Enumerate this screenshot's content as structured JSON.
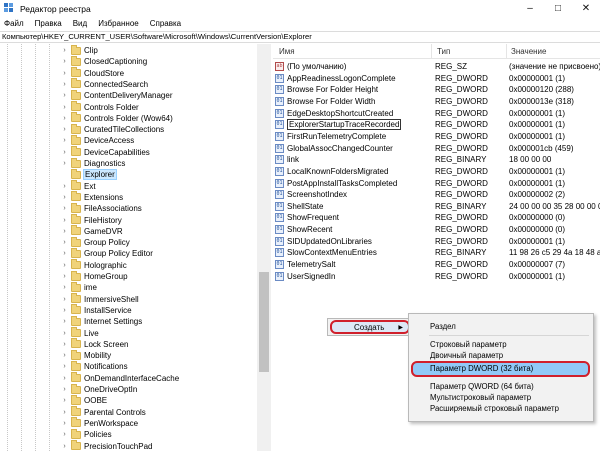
{
  "window": {
    "title": "Редактор реестра"
  },
  "menu": [
    "Файл",
    "Правка",
    "Вид",
    "Избранное",
    "Справка"
  ],
  "address": "Компьютер\\HKEY_CURRENT_USER\\Software\\Microsoft\\Windows\\CurrentVersion\\Explorer",
  "tree": {
    "items": [
      "Clip",
      "ClosedCaptioning",
      "CloudStore",
      "ConnectedSearch",
      "ContentDeliveryManager",
      "Controls Folder",
      "Controls Folder (Wow64)",
      "CuratedTileCollections",
      "DeviceAccess",
      "DeviceCapabilities",
      "Diagnostics",
      "Explorer",
      "Ext",
      "Extensions",
      "FileAssociations",
      "FileHistory",
      "GameDVR",
      "Group Policy",
      "Group Policy Editor",
      "Holographic",
      "HomeGroup",
      "ime",
      "ImmersiveShell",
      "InstallService",
      "Internet Settings",
      "Live",
      "Lock Screen",
      "Mobility",
      "Notifications",
      "OnDemandInterfaceCache",
      "OneDriveOptIn",
      "OOBE",
      "Parental Controls",
      "PenWorkspace",
      "Policies",
      "PrecisionTouchPad"
    ],
    "expandable": [
      true,
      true,
      true,
      true,
      true,
      true,
      true,
      true,
      true,
      true,
      true,
      false,
      true,
      true,
      true,
      true,
      true,
      true,
      true,
      true,
      true,
      true,
      true,
      true,
      true,
      true,
      true,
      true,
      true,
      true,
      true,
      true,
      true,
      true,
      true,
      true
    ],
    "selected_index": 11
  },
  "list": {
    "headers": {
      "name": "Имя",
      "type": "Тип",
      "value": "Значение"
    },
    "rows": [
      {
        "icon": "sz",
        "name": "(По умолчанию)",
        "type": "REG_SZ",
        "value": "(значение не присвоено)"
      },
      {
        "icon": "bin",
        "name": "AppReadinessLogonComplete",
        "type": "REG_DWORD",
        "value": "0x00000001 (1)"
      },
      {
        "icon": "bin",
        "name": "Browse For Folder Height",
        "type": "REG_DWORD",
        "value": "0x00000120 (288)"
      },
      {
        "icon": "bin",
        "name": "Browse For Folder Width",
        "type": "REG_DWORD",
        "value": "0x0000013e (318)"
      },
      {
        "icon": "bin",
        "name": "EdgeDesktopShortcutCreated",
        "type": "REG_DWORD",
        "value": "0x00000001 (1)"
      },
      {
        "icon": "bin",
        "name": "ExplorerStartupTraceRecorded",
        "type": "REG_DWORD",
        "value": "0x00000001 (1)"
      },
      {
        "icon": "bin",
        "name": "FirstRunTelemetryComplete",
        "type": "REG_DWORD",
        "value": "0x00000001 (1)"
      },
      {
        "icon": "bin",
        "name": "GlobalAssocChangedCounter",
        "type": "REG_DWORD",
        "value": "0x000001cb (459)"
      },
      {
        "icon": "bin",
        "name": "link",
        "type": "REG_BINARY",
        "value": "18 00 00 00"
      },
      {
        "icon": "bin",
        "name": "LocalKnownFoldersMigrated",
        "type": "REG_DWORD",
        "value": "0x00000001 (1)"
      },
      {
        "icon": "bin",
        "name": "PostAppInstallTasksCompleted",
        "type": "REG_DWORD",
        "value": "0x00000001 (1)"
      },
      {
        "icon": "bin",
        "name": "ScreenshotIndex",
        "type": "REG_DWORD",
        "value": "0x00000002 (2)"
      },
      {
        "icon": "bin",
        "name": "ShellState",
        "type": "REG_BINARY",
        "value": "24 00 00 00 35 28 00 00 00 00"
      },
      {
        "icon": "bin",
        "name": "ShowFrequent",
        "type": "REG_DWORD",
        "value": "0x00000000 (0)"
      },
      {
        "icon": "bin",
        "name": "ShowRecent",
        "type": "REG_DWORD",
        "value": "0x00000000 (0)"
      },
      {
        "icon": "bin",
        "name": "SIDUpdatedOnLibraries",
        "type": "REG_DWORD",
        "value": "0x00000001 (1)"
      },
      {
        "icon": "bin",
        "name": "SlowContextMenuEntries",
        "type": "REG_BINARY",
        "value": "11 98 26 c5 29 4a 18 48 a4 b"
      },
      {
        "icon": "bin",
        "name": "TelemetrySalt",
        "type": "REG_DWORD",
        "value": "0x00000007 (7)"
      },
      {
        "icon": "bin",
        "name": "UserSignedIn",
        "type": "REG_DWORD",
        "value": "0x00000001 (1)"
      }
    ],
    "outlined_index": 5
  },
  "context_menu": {
    "create_label": "Создать",
    "submenu": [
      {
        "label": "Раздел"
      },
      {
        "label": "Строковый параметр"
      },
      {
        "label": "Двоичный параметр"
      },
      {
        "label": "Параметр DWORD (32 бита)",
        "highlight": true
      },
      {
        "label": "Параметр QWORD (64 бита)"
      },
      {
        "label": "Мультистроковый параметр"
      },
      {
        "label": "Расширяемый строковый параметр"
      }
    ]
  }
}
